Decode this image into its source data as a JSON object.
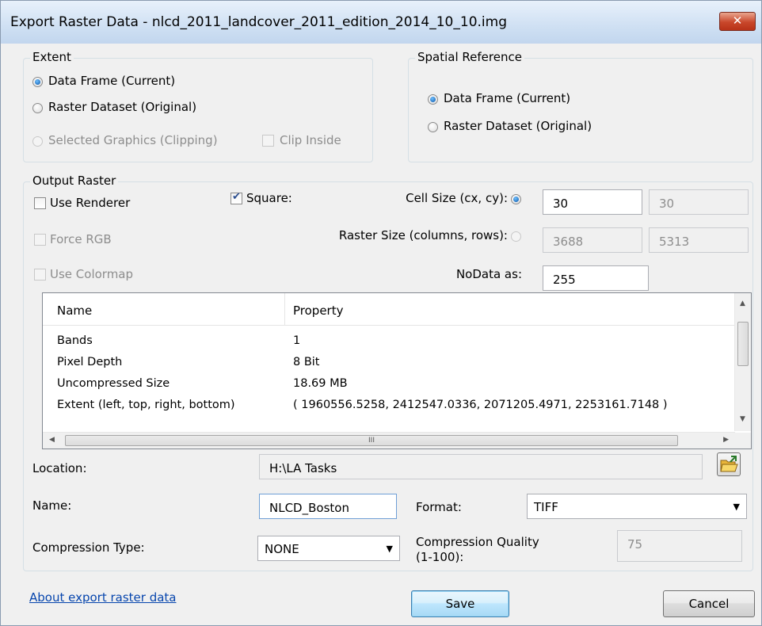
{
  "window": {
    "title": "Export Raster Data - nlcd_2011_landcover_2011_edition_2014_10_10.img",
    "close_glyph": "✕"
  },
  "extent": {
    "label": "Extent",
    "options": [
      "Data Frame (Current)",
      "Raster Dataset (Original)",
      "Selected Graphics (Clipping)"
    ],
    "selected": "Data Frame (Current)",
    "clip_inside_label": "Clip Inside"
  },
  "spatial_reference": {
    "label": "Spatial Reference",
    "options": [
      "Data Frame (Current)",
      "Raster Dataset (Original)"
    ],
    "selected": "Data Frame (Current)"
  },
  "output_raster": {
    "label": "Output Raster",
    "use_renderer_label": "Use Renderer",
    "force_rgb_label": "Force RGB",
    "use_colormap_label": "Use Colormap",
    "square_label": "Square:",
    "square_checked": true,
    "cell_size_label": "Cell Size (cx, cy):",
    "cell_size_cx": "30",
    "cell_size_cy": "30",
    "raster_size_label": "Raster Size (columns, rows):",
    "raster_columns": "3688",
    "raster_rows": "5313",
    "nodata_label": "NoData as:",
    "nodata_value": "255"
  },
  "properties": {
    "headers": [
      "Name",
      "Property"
    ],
    "rows": [
      [
        "Bands",
        "1"
      ],
      [
        "Pixel Depth",
        "8 Bit"
      ],
      [
        "Uncompressed Size",
        "18.69 MB"
      ],
      [
        "Extent (left, top, right, bottom)",
        "( 1960556.5258, 2412547.0336, 2071205.4971, 2253161.7148 )"
      ]
    ],
    "hscroll_grip": "III"
  },
  "location": {
    "label": "Location:",
    "value": "H:\\LA Tasks"
  },
  "name": {
    "label": "Name:",
    "value": "NLCD_Boston"
  },
  "format": {
    "label": "Format:",
    "value": "TIFF"
  },
  "compression": {
    "type_label": "Compression Type:",
    "type_value": "NONE",
    "quality_label_line1": "Compression Quality",
    "quality_label_line2": "(1-100):",
    "quality_value": "75"
  },
  "footer": {
    "about_link": "About export raster data",
    "save_label": "Save",
    "cancel_label": "Cancel"
  },
  "icons": {
    "folder": "open-folder-icon",
    "dropdown": "▼"
  }
}
